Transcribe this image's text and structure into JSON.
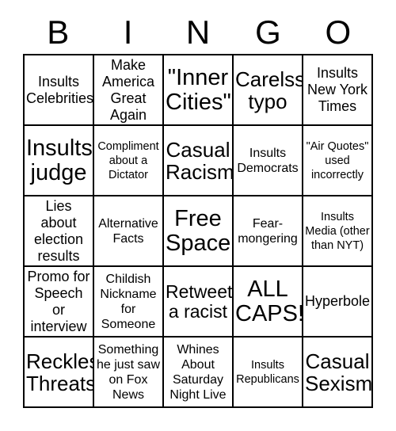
{
  "card": {
    "title": "BINGO",
    "header_letters": [
      "B",
      "I",
      "N",
      "G",
      "O"
    ],
    "colors": {
      "background": "#ffffff",
      "text": "#000000",
      "border": "#000000"
    },
    "grid": {
      "rows": 5,
      "columns": 5,
      "free_space_index": 12
    },
    "cells": [
      {
        "text": "Insults Celebrities",
        "size": "fs-md",
        "free": false
      },
      {
        "text": "Make America Great Again",
        "size": "fs-md",
        "free": false
      },
      {
        "text": "\"Inner Cities\"",
        "size": "fs-xxl",
        "free": false
      },
      {
        "text": "Carelss typo",
        "size": "fs-xl",
        "free": false
      },
      {
        "text": "Insults New York Times",
        "size": "fs-md",
        "free": false
      },
      {
        "text": "Insults judge",
        "size": "fs-xxl",
        "free": false
      },
      {
        "text": "Compliment about a Dictator",
        "size": "fs-xs",
        "free": false
      },
      {
        "text": "Casual Racism",
        "size": "fs-xl",
        "free": false
      },
      {
        "text": "Insults Democrats",
        "size": "fs-sm",
        "free": false
      },
      {
        "text": "\"Air Quotes\" used incorrectly",
        "size": "fs-xs",
        "free": false
      },
      {
        "text": "Lies about election results",
        "size": "fs-md",
        "free": false
      },
      {
        "text": "Alternative Facts",
        "size": "fs-sm",
        "free": false
      },
      {
        "text": "Free Space!",
        "size": "fs-xxl",
        "free": true
      },
      {
        "text": "Fear-mongering",
        "size": "fs-sm",
        "free": false
      },
      {
        "text": "Insults Media (other than NYT)",
        "size": "fs-xs",
        "free": false
      },
      {
        "text": "Promo for Speech or interview",
        "size": "fs-md",
        "free": false
      },
      {
        "text": "Childish Nickname for Someone",
        "size": "fs-sm",
        "free": false
      },
      {
        "text": "Retweets a racist",
        "size": "fs-lg",
        "free": false
      },
      {
        "text": "ALL CAPS!",
        "size": "fs-xxl",
        "free": false
      },
      {
        "text": "Hyperbole",
        "size": "fs-md",
        "free": false
      },
      {
        "text": "Reckless Threats",
        "size": "fs-xl",
        "free": false
      },
      {
        "text": "Something he just saw on Fox News",
        "size": "fs-sm",
        "free": false
      },
      {
        "text": "Whines About Saturday Night Live",
        "size": "fs-sm",
        "free": false
      },
      {
        "text": "Insults Republicans",
        "size": "fs-xs",
        "free": false
      },
      {
        "text": "Casual Sexism",
        "size": "fs-xl",
        "free": false
      }
    ]
  }
}
